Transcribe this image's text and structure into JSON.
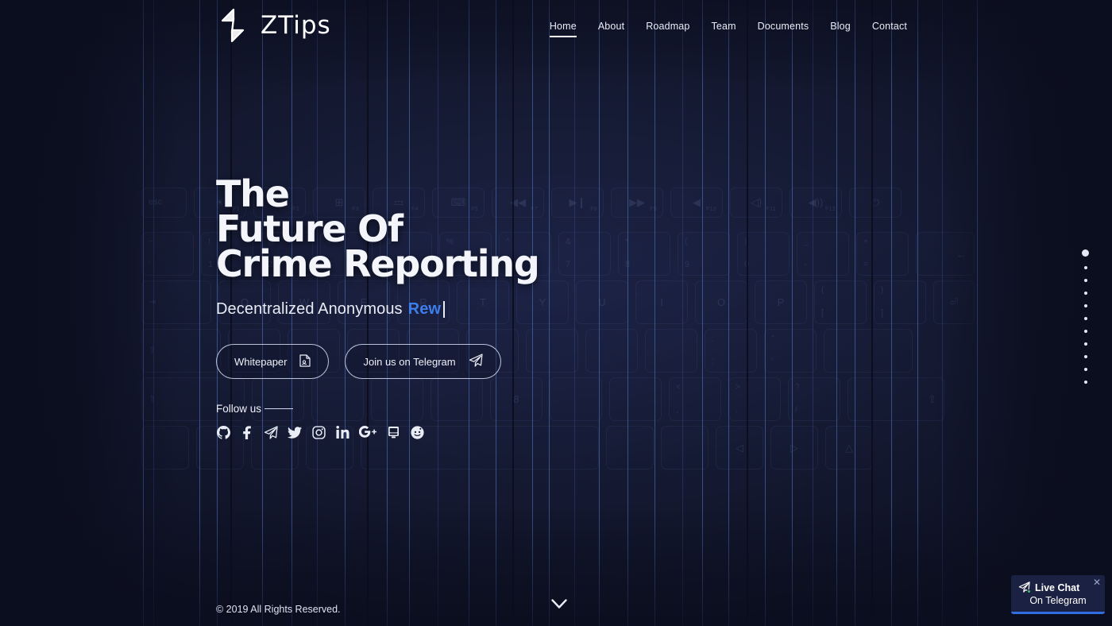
{
  "site": {
    "brand_name": "ZTips",
    "logo_icon": "lightning-z-logo-icon",
    "accent_color": "#3e7dec",
    "background_color": "#161b35"
  },
  "nav": {
    "items": [
      {
        "label": "Home",
        "active": true
      },
      {
        "label": "About",
        "active": false
      },
      {
        "label": "Roadmap",
        "active": false
      },
      {
        "label": "Team",
        "active": false
      },
      {
        "label": "Documents",
        "active": false
      },
      {
        "label": "Blog",
        "active": false
      },
      {
        "label": "Contact",
        "active": false
      }
    ]
  },
  "hero": {
    "title_lines": [
      "The",
      "Future Of",
      "Crime Reporting"
    ],
    "subtitle_static": "Decentralized Anonymous",
    "subtitle_typed": "Rew",
    "buttons": [
      {
        "label": "Whitepaper",
        "icon": "document-file-icon"
      },
      {
        "label": "Join us on Telegram",
        "icon": "paper-plane-icon"
      }
    ],
    "follow_label": "Follow us",
    "socials": [
      {
        "name": "github-icon"
      },
      {
        "name": "facebook-icon"
      },
      {
        "name": "telegram-icon"
      },
      {
        "name": "twitter-icon"
      },
      {
        "name": "instagram-icon"
      },
      {
        "name": "linkedin-icon"
      },
      {
        "name": "google-plus-icon"
      },
      {
        "name": "youtube-icon"
      },
      {
        "name": "reddit-icon"
      }
    ]
  },
  "footer": {
    "copyright": "© 2019 All Rights Reserved."
  },
  "side_nav": {
    "total_dots": 11,
    "active_index": 0
  },
  "scroll_indicator": {
    "icon": "chevron-down-icon"
  },
  "live_chat": {
    "title": "Live Chat",
    "subtitle": "On Telegram",
    "icon": "paper-plane-icon",
    "status": "online",
    "close_label": "✕",
    "accent_color": "#2f6de0"
  },
  "background": {
    "description": "dark blue keyboard photo with vertical blueprint grid lines",
    "keyboard_fn_labels": [
      "F8",
      "F9",
      "F10",
      "F11",
      "F12"
    ],
    "key_glyphs": [
      "esc",
      "☀",
      "▤",
      "▭",
      "⌨",
      "◀◀",
      "▶❙❙",
      "▶▶",
      "◀",
      "◁",
      "◀)",
      "⏻",
      "!",
      "@",
      "#",
      "$",
      "%",
      "^",
      "&",
      "*",
      "(",
      ")",
      "_",
      "+",
      "1",
      "2",
      "3",
      "4",
      "5",
      "6",
      "7",
      "8",
      "9",
      "0",
      "-",
      "=",
      "Q",
      "W",
      "E",
      "R",
      "T",
      "Y",
      "U",
      "I",
      "O",
      "P",
      "{",
      "}",
      "|"
    ]
  }
}
